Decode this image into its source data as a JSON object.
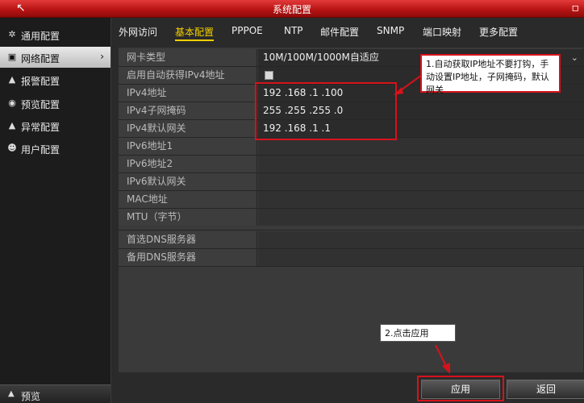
{
  "window": {
    "title": "系统配置"
  },
  "sidebar": {
    "items": [
      {
        "label": "通用配置",
        "icon": "gear-icon"
      },
      {
        "label": "网络配置",
        "icon": "network-icon"
      },
      {
        "label": "报警配置",
        "icon": "bell-icon"
      },
      {
        "label": "预览配置",
        "icon": "eye-icon"
      },
      {
        "label": "异常配置",
        "icon": "warning-icon"
      },
      {
        "label": "用户配置",
        "icon": "users-icon"
      }
    ],
    "active_index": 1,
    "bottom_label": "预览"
  },
  "tabs": [
    {
      "label": "外网访问"
    },
    {
      "label": "基本配置"
    },
    {
      "label": "PPPOE"
    },
    {
      "label": "NTP"
    },
    {
      "label": "邮件配置"
    },
    {
      "label": "SNMP"
    },
    {
      "label": "端口映射"
    },
    {
      "label": "更多配置"
    }
  ],
  "active_tab": 1,
  "form": {
    "rows": [
      {
        "label": "网卡类型",
        "value": "10M/100M/1000M自适应"
      },
      {
        "label": "启用自动获得IPv4地址",
        "value": ""
      },
      {
        "label": "IPv4地址",
        "value": "192 .168 .1    .100"
      },
      {
        "label": "IPv4子网掩码",
        "value": "255 .255 .255 .0"
      },
      {
        "label": "IPv4默认网关",
        "value": "192 .168 .1    .1"
      },
      {
        "label": "IPv6地址1",
        "value": ""
      },
      {
        "label": "IPv6地址2",
        "value": ""
      },
      {
        "label": "IPv6默认网关",
        "value": ""
      },
      {
        "label": "MAC地址",
        "value": ""
      },
      {
        "label": "MTU（字节）",
        "value": ""
      },
      {
        "label": "首选DNS服务器",
        "value": ""
      },
      {
        "label": "备用DNS服务器",
        "value": ""
      }
    ]
  },
  "annotations": {
    "callout1": "1.自动获取IP地址不要打钩，手动设置IP地址，子网掩码，默认网关",
    "callout2": "2.点击应用",
    "accent_color": "#d6121b"
  },
  "buttons": {
    "apply": "应用",
    "back": "返回"
  }
}
